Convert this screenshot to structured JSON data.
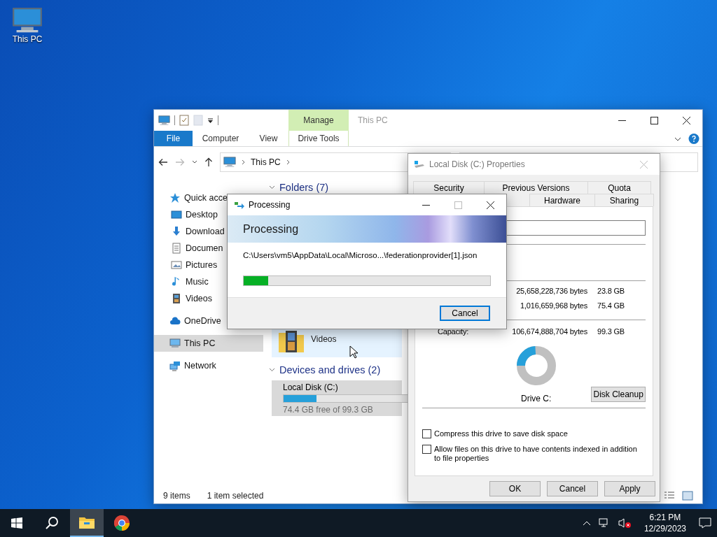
{
  "desktop": {
    "icons": [
      {
        "label": "This PC"
      }
    ]
  },
  "explorer": {
    "title": "This PC",
    "context_group": "Manage",
    "ribbon_tabs": [
      {
        "label": "File",
        "kind": "file"
      },
      {
        "label": "Computer",
        "kind": "tab"
      },
      {
        "label": "View",
        "kind": "tab"
      },
      {
        "label": "Drive Tools",
        "kind": "context"
      }
    ],
    "address": [
      "This PC"
    ],
    "nav": [
      {
        "label": "Quick acce",
        "kind": "star",
        "selected": false
      },
      {
        "label": "Desktop",
        "kind": "desktop",
        "selected": false
      },
      {
        "label": "Download",
        "kind": "download",
        "selected": false
      },
      {
        "label": "Documen",
        "kind": "document",
        "selected": false
      },
      {
        "label": "Pictures",
        "kind": "picture",
        "selected": false
      },
      {
        "label": "Music",
        "kind": "music",
        "selected": false
      },
      {
        "label": "Videos",
        "kind": "video",
        "selected": false
      },
      {
        "label": "OneDrive",
        "kind": "cloud",
        "selected": false
      },
      {
        "label": "This PC",
        "kind": "pc",
        "selected": true
      },
      {
        "label": "Network",
        "kind": "network",
        "selected": false
      }
    ],
    "folders_header": "Folders (7)",
    "folders": [
      {
        "label": "Videos",
        "selected": true
      }
    ],
    "drives_header": "Devices and drives (2)",
    "drives": [
      {
        "name": "Local Disk (C:)",
        "level": 0.25,
        "free": "74.4 GB free of 99.3 GB",
        "selected": true
      }
    ],
    "status": [
      "9 items",
      "1 item selected"
    ]
  },
  "properties": {
    "title": "Local Disk (C:) Properties",
    "tabs_row1": [
      {
        "label": "Security",
        "selected": false
      },
      {
        "label": "Previous Versions",
        "selected": false
      },
      {
        "label": "Quota",
        "selected": false
      }
    ],
    "tabs_row2": [
      {
        "label": "Hardware",
        "selected": false
      },
      {
        "label": "Sharing",
        "selected": false
      }
    ],
    "usage": [
      {
        "bytes": "25,658,228,736 bytes",
        "size": "23.8 GB"
      },
      {
        "bytes": "1,016,659,968 bytes",
        "size": "75.4 GB"
      }
    ],
    "capacity": {
      "label": "Capacity:",
      "bytes": "106,674,888,704 bytes",
      "size": "99.3 GB"
    },
    "drive_label": "Drive C:",
    "cleanup_button": "Disk Cleanup",
    "options": [
      {
        "label": "Compress this drive to save disk space",
        "checked": false
      },
      {
        "label": "Allow files on this drive to have contents indexed in addition to file properties",
        "checked": false
      }
    ],
    "buttons": [
      "OK",
      "Cancel",
      "Apply"
    ]
  },
  "processing": {
    "title": "Processing",
    "heading": "Processing",
    "path": "C:\\Users\\vm5\\AppData\\Local\\Microso...\\federationprovider[1].json",
    "level": 0.1,
    "button": "Cancel"
  },
  "taskbar": {
    "apps": [
      {
        "kind": "start",
        "active": false
      },
      {
        "kind": "search",
        "active": false
      },
      {
        "kind": "explorer",
        "active": true
      },
      {
        "kind": "chrome",
        "active": false
      }
    ],
    "time": "6:21 PM",
    "date": "12/29/2023"
  }
}
